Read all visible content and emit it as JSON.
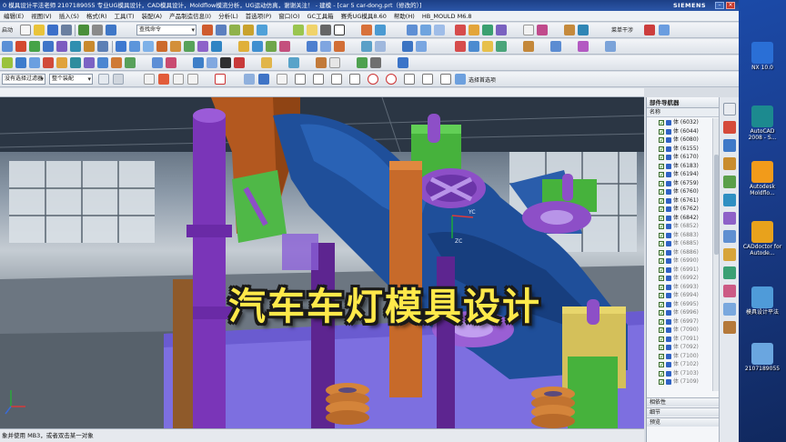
{
  "window": {
    "title": "0 模具设计平法老师 2107189055 专业UG模具设计，CAD模具设计，Moldflow模流分析，UG运动仿真，谢谢关注！ - 建模 - [car 5 car-dong.prt（修改的）]",
    "brand": "SIEMENS",
    "min": "–",
    "max": "□",
    "close": "×"
  },
  "menu": [
    "编辑(E)",
    "视图(V)",
    "插入(S)",
    "格式(R)",
    "工具(T)",
    "装配(A)",
    "产品制造信息(I)",
    "分析(L)",
    "首选项(P)",
    "窗口(O)",
    "GC工具箱",
    "赛秀UG模具8.60",
    "帮助(H)",
    "HB_MOULD M6.8"
  ],
  "toolbar": {
    "start_label": "启动",
    "search_placeholder": "查找命令",
    "shrink_label": "菜单干涉",
    "selection_filter": "没有选择过滤器",
    "assembly_scope": "整个装配",
    "select_group": "选择首选项"
  },
  "overlay": {
    "title": "汽车车灯模具设计"
  },
  "viewport": {
    "axis_labels": [
      "YC",
      "ZC"
    ]
  },
  "status": {
    "text": "象并使用 MB3，或者双击某一对象"
  },
  "navigator": {
    "title": "部件导航器",
    "column": "名称",
    "items": [
      {
        "label": "体 (6032)",
        "faded": false
      },
      {
        "label": "体 (6044)",
        "faded": false
      },
      {
        "label": "体 (6080)",
        "faded": false
      },
      {
        "label": "体 (6155)",
        "faded": false
      },
      {
        "label": "体 (6170)",
        "faded": false
      },
      {
        "label": "体 (6183)",
        "faded": false
      },
      {
        "label": "体 (6194)",
        "faded": false
      },
      {
        "label": "体 (6759)",
        "faded": false
      },
      {
        "label": "体 (6760)",
        "faded": false
      },
      {
        "label": "体 (6761)",
        "faded": false
      },
      {
        "label": "体 (6762)",
        "faded": false
      },
      {
        "label": "体 (6842)",
        "faded": false
      },
      {
        "label": "体 (6852)",
        "faded": true
      },
      {
        "label": "体 (6883)",
        "faded": true
      },
      {
        "label": "体 (6885)",
        "faded": true
      },
      {
        "label": "体 (6886)",
        "faded": true
      },
      {
        "label": "体 (6990)",
        "faded": true
      },
      {
        "label": "体 (6991)",
        "faded": true
      },
      {
        "label": "体 (6992)",
        "faded": true
      },
      {
        "label": "体 (6993)",
        "faded": true
      },
      {
        "label": "体 (6994)",
        "faded": true
      },
      {
        "label": "体 (6995)",
        "faded": true
      },
      {
        "label": "体 (6996)",
        "faded": true
      },
      {
        "label": "体 (6997)",
        "faded": true
      },
      {
        "label": "体 (7090)",
        "faded": true
      },
      {
        "label": "体 (7091)",
        "faded": true
      },
      {
        "label": "体 (7092)",
        "faded": true
      },
      {
        "label": "体 (7100)",
        "faded": true
      },
      {
        "label": "体 (7102)",
        "faded": true
      },
      {
        "label": "体 (7103)",
        "faded": true
      },
      {
        "label": "体 (7109)",
        "faded": true
      }
    ],
    "sections": [
      "相依性",
      "细节",
      "预览"
    ]
  },
  "desktop": {
    "icons": [
      {
        "label": "NX 10.0",
        "color": "#2a6fd6"
      },
      {
        "label": "AutoCAD 2008 - S...",
        "color": "#1c8a8f"
      },
      {
        "label": "Autodesk Moldflo...",
        "color": "#f29b1a"
      },
      {
        "label": "CADdoctor for Autode...",
        "color": "#e8a21c"
      },
      {
        "label": "模具设计平法",
        "color": "#4f9bd9"
      },
      {
        "label": "2107189055",
        "color": "#6aa6e0"
      }
    ]
  },
  "colors": {
    "accent": "#1c3f86",
    "overlay_text": "#ffe94a",
    "model_blue": "#1f4f9a",
    "model_purple": "#8d4fc7",
    "model_green": "#46b23c",
    "model_brown": "#a0521d",
    "model_orange": "#c76a2a"
  }
}
